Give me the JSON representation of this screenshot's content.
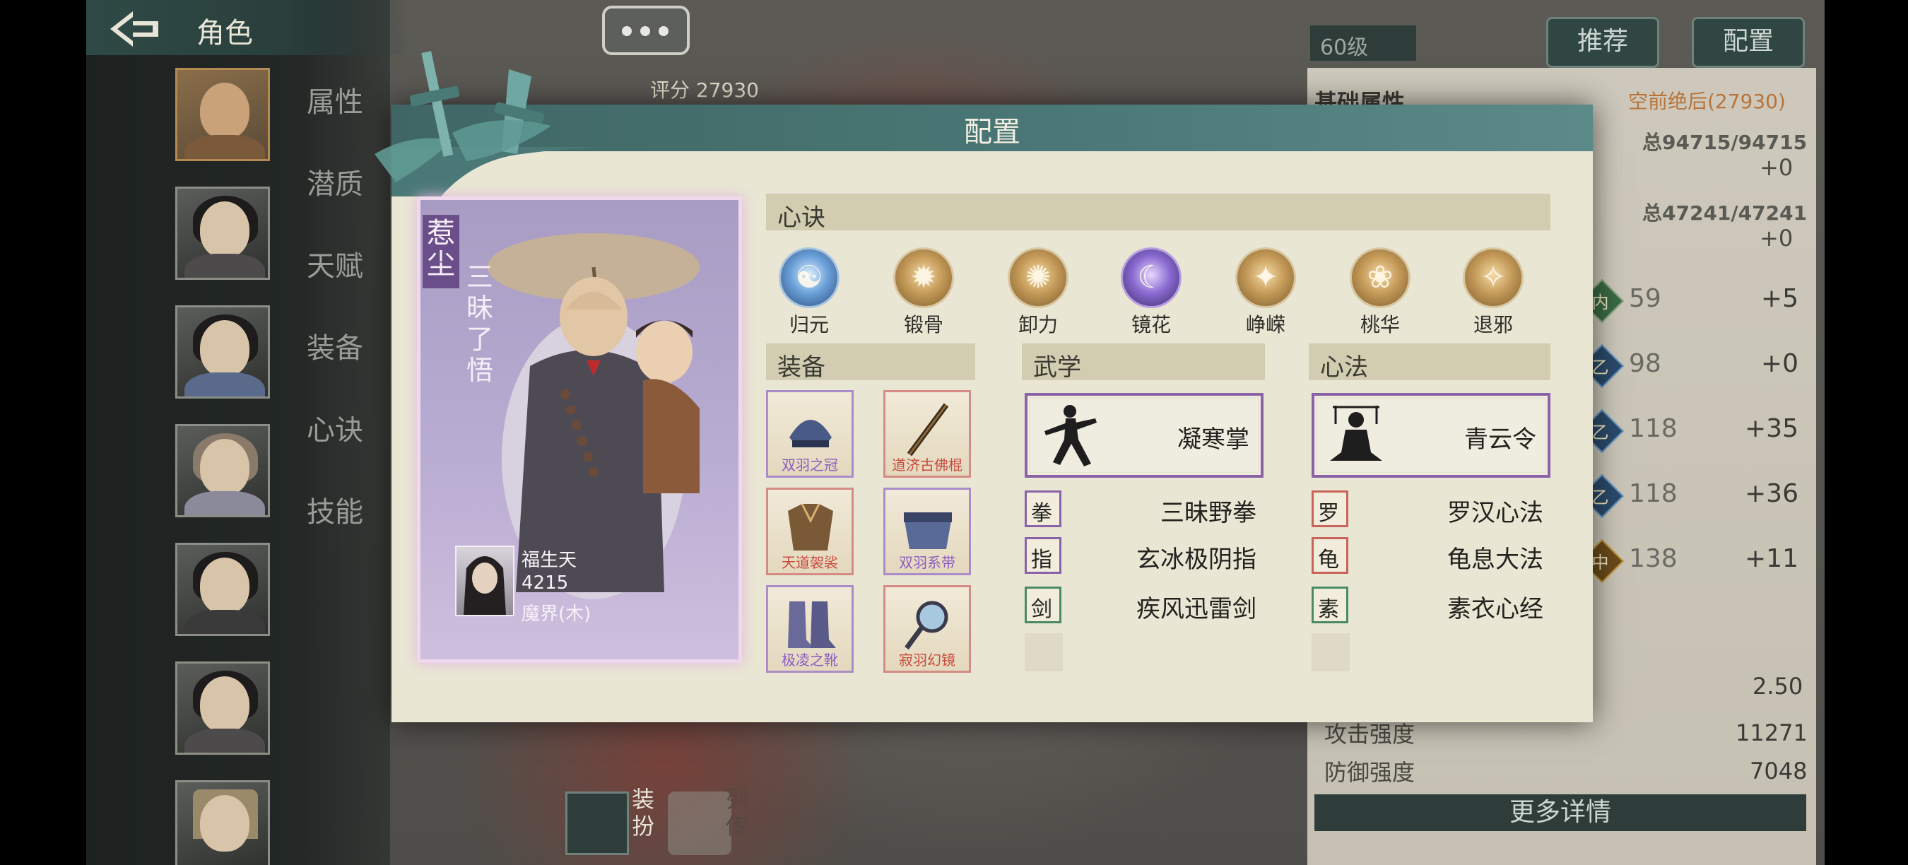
{
  "screen": {
    "header_title": "角色",
    "side_tabs": [
      "属性",
      "潜质",
      "天赋",
      "装备",
      "心诀",
      "技能"
    ],
    "score_label": "评分",
    "score_value": "27930",
    "level": "60级",
    "buttons": {
      "recommend": "推荐",
      "config": "配置"
    },
    "right_panel": {
      "base_attr_label": "基础属性",
      "rank_text": "空前绝后(27930)",
      "hp_total": "总94715/94715",
      "hp_bonus": "+0",
      "mp_total": "总47241/47241",
      "mp_bonus": "+0",
      "stats": [
        {
          "icon": "内",
          "value": "59",
          "bonus": "+5",
          "color": "green"
        },
        {
          "icon": "乙",
          "value": "98",
          "bonus": "+0",
          "color": "blue"
        },
        {
          "icon": "乙",
          "value": "118",
          "bonus": "+35",
          "color": "blue"
        },
        {
          "icon": "乙",
          "value": "118",
          "bonus": "+36",
          "color": "blue"
        },
        {
          "icon": "中",
          "value": "138",
          "bonus": "+11",
          "color": "gold"
        }
      ],
      "speed_value": "2.50",
      "attack_label": "攻击强度",
      "attack_value": "11271",
      "defense_label": "防御强度",
      "defense_value": "7048",
      "more_details": "更多详情"
    },
    "bottom": {
      "dress_label": "装扮",
      "bio_label": "列传"
    }
  },
  "dialog": {
    "title": "配置",
    "card": {
      "name": "惹尘",
      "epithet": "三昧了悟",
      "master_name": "福生天",
      "master_score": "4215",
      "master_realm": "魔界(木)"
    },
    "xinjue_title": "心诀",
    "xinjue": [
      {
        "label": "归元",
        "style": "blue",
        "glyph": "☯"
      },
      {
        "label": "锻骨",
        "style": "gold",
        "glyph": "✹"
      },
      {
        "label": "卸力",
        "style": "gold",
        "glyph": "✺"
      },
      {
        "label": "镜花",
        "style": "purple",
        "glyph": "☾"
      },
      {
        "label": "峥嵘",
        "style": "gold",
        "glyph": "✦"
      },
      {
        "label": "桃华",
        "style": "gold",
        "glyph": "❀"
      },
      {
        "label": "退邪",
        "style": "gold",
        "glyph": "✧"
      }
    ],
    "equip_title": "装备",
    "equipment": [
      {
        "name": "双羽之冠",
        "rarity": "purple"
      },
      {
        "name": "道济古佛棍",
        "rarity": "red"
      },
      {
        "name": "天道袈裟",
        "rarity": "red"
      },
      {
        "name": "双羽系带",
        "rarity": "purple"
      },
      {
        "name": "极凌之靴",
        "rarity": "purple"
      },
      {
        "name": "寂羽幻镜",
        "rarity": "red"
      }
    ],
    "wuxue_title": "武学",
    "wuxue_main": "凝寒掌",
    "wuxue": [
      {
        "name": "三昧野拳",
        "rarity": "purple",
        "glyph": "拳"
      },
      {
        "name": "玄冰极阴指",
        "rarity": "purple",
        "glyph": "指"
      },
      {
        "name": "疾风迅雷剑",
        "rarity": "green",
        "glyph": "剑"
      }
    ],
    "xinfa_title": "心法",
    "xinfa_main": "青云令",
    "xinfa": [
      {
        "name": "罗汉心法",
        "rarity": "red",
        "glyph": "罗"
      },
      {
        "name": "龟息大法",
        "rarity": "red",
        "glyph": "龟"
      },
      {
        "name": "素衣心经",
        "rarity": "green",
        "glyph": "素"
      }
    ]
  }
}
